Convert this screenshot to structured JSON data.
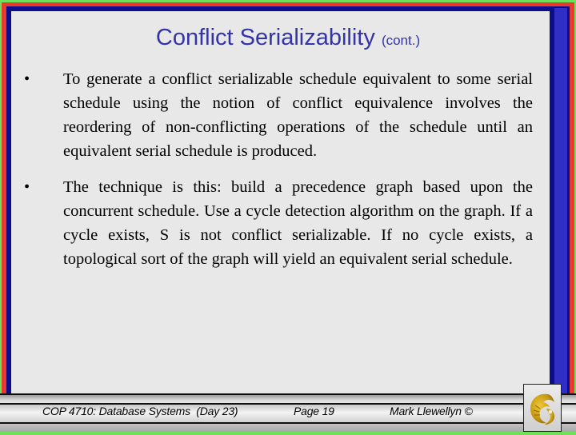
{
  "slide": {
    "title": "Conflict Serializability",
    "title_suffix": "(cont.)",
    "bullets": [
      {
        "marker": "•",
        "text": "To generate a conflict serializable schedule equivalent to some serial schedule using the notion of conflict equivalence involves the reordering of non-conflicting operations of the schedule until an equivalent serial schedule is produced."
      },
      {
        "marker": "•",
        "text": "The technique is this:  build a precedence graph based upon the concurrent schedule.  Use a cycle detection algorithm on the graph.  If a cycle exists, S is not conflict serializable.  If no cycle exists, a topological sort of the graph will yield an equivalent serial schedule."
      }
    ]
  },
  "footer": {
    "course": "COP 4710: Database Systems  (Day 23)",
    "page": "Page 19",
    "author": "Mark Llewellyn ©",
    "logo_icon": "ucf-pegasus-logo-icon"
  },
  "colors": {
    "title": "#3434a8",
    "frame_green": "#6ee05a",
    "frame_red": "#e8392e",
    "frame_navy": "#0d0d8c",
    "frame_blue": "#2f2fc8",
    "slide_bg": "#e8e8e8",
    "logo_gold": "#d4a017"
  }
}
